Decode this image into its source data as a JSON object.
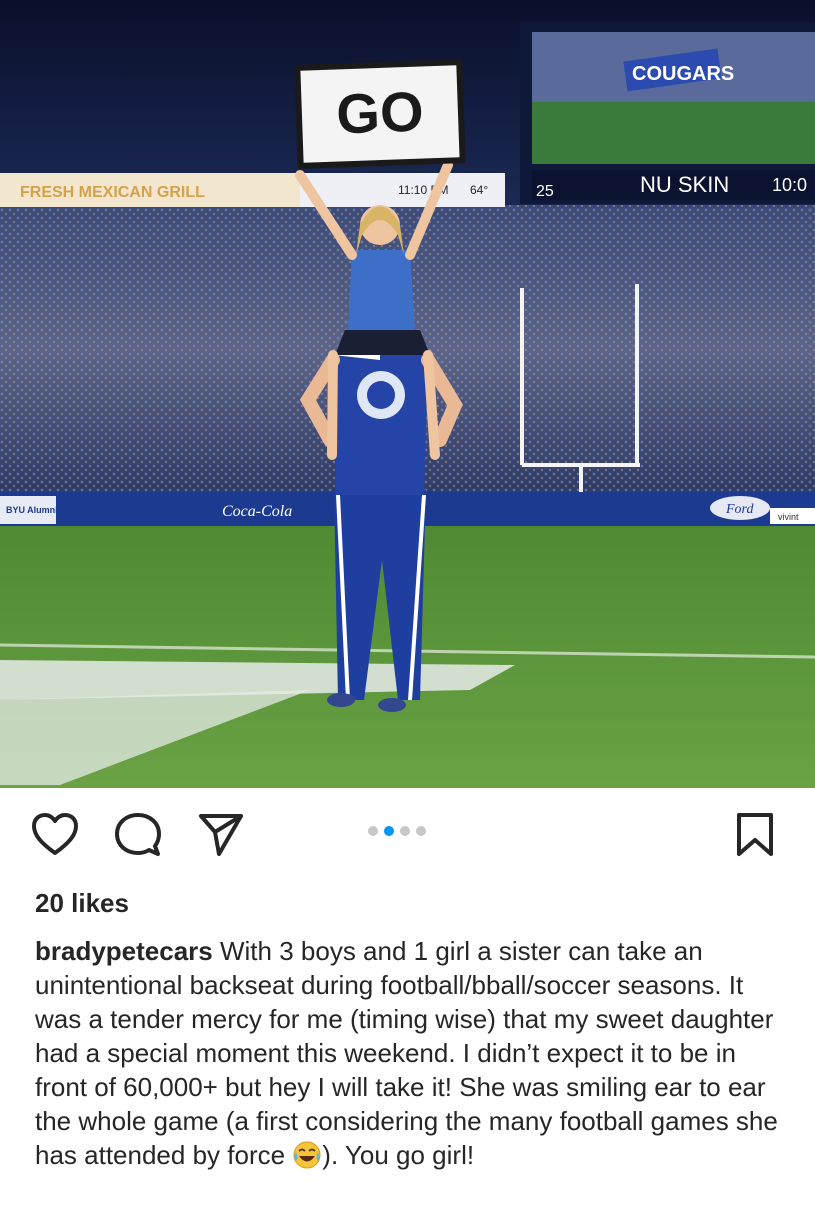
{
  "photo": {
    "sign_text": "GO",
    "board_text": "COUGARS",
    "scoreboard": {
      "sponsor": "NU SKIN",
      "left_number": "25",
      "right_score": "10:0",
      "time": "11:10 PM",
      "temp": "64°"
    },
    "ribbon_text": "FRESH MEXICAN GRILL",
    "banners": [
      "BYU Alumni",
      "Coca-Cola",
      "Ford",
      "vivint"
    ]
  },
  "carousel": {
    "count": 4,
    "active_index": 1
  },
  "post": {
    "likes": "20 likes",
    "username": "bradypetecars",
    "caption_before_emoji": " With 3 boys and 1 girl a sister can take an unintentional backseat during football/bball/soccer seasons.  It was a tender mercy for me (timing wise) that my sweet daughter had a special moment this weekend.  I didn’t expect it to be in front of 60,000+ but hey I will take it!  She was smiling ear to ear the whole game (a first considering the many football games she has attended by force ",
    "emoji": "face-with-tears-of-joy",
    "caption_after_emoji": "). You go girl!"
  },
  "colors": {
    "accent": "#0095f6",
    "byu_blue": "#1f3fa0",
    "field_green": "#5f9a3a"
  }
}
